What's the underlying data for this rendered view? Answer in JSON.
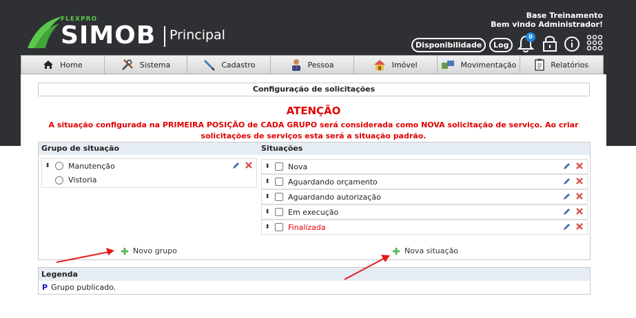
{
  "header": {
    "brand_small": "FLEXPRO",
    "brand": "SIMOB",
    "module": "Principal",
    "company": "Base Treinamento",
    "welcome": "Bem vindo Administrador!",
    "availability_label": "Disponibilidade",
    "log_label": "Log",
    "notification_count": "0"
  },
  "nav": {
    "items": [
      {
        "label": "Home",
        "icon": "home-icon"
      },
      {
        "label": "Sistema",
        "icon": "tools-icon"
      },
      {
        "label": "Cadastro",
        "icon": "pen-icon"
      },
      {
        "label": "Pessoa",
        "icon": "person-icon"
      },
      {
        "label": "Imóvel",
        "icon": "house-icon"
      },
      {
        "label": "Movimentação",
        "icon": "transfer-icon"
      },
      {
        "label": "Relatórios",
        "icon": "clipboard-icon"
      }
    ]
  },
  "main": {
    "title": "Configuração de solicitações",
    "attention": "ATENÇÃO",
    "message_line1": "A situação configurada na PRIMEIRA POSIÇÃO de CADA GRUPO será considerada como NOVA solicitação de serviço. Ao criar",
    "message_line2": "solicitações de serviços esta será a situação padrão.",
    "groups_header": "Grupo de situação",
    "situations_header": "Situações",
    "groups": [
      "Manutenção",
      "Vistoria"
    ],
    "situations": [
      {
        "label": "Nova",
        "color": "#222222"
      },
      {
        "label": "Aguardando orçamento",
        "color": "#222222"
      },
      {
        "label": "Aguardando autorização",
        "color": "#222222"
      },
      {
        "label": "Em execução",
        "color": "#222222"
      },
      {
        "label": "Finalizada",
        "color": "#e10000"
      }
    ],
    "add_group_label": "Novo grupo",
    "add_situation_label": "Nova situação"
  },
  "legend": {
    "title": "Legenda",
    "key": "P",
    "description": "Grupo publicado."
  },
  "colors": {
    "header_bg": "#2e3033",
    "brand_green": "#5cc84a",
    "alert_red": "#e10000",
    "section_header_bg": "#e6ecf3",
    "annotation_arrow": "#e51c1c"
  }
}
